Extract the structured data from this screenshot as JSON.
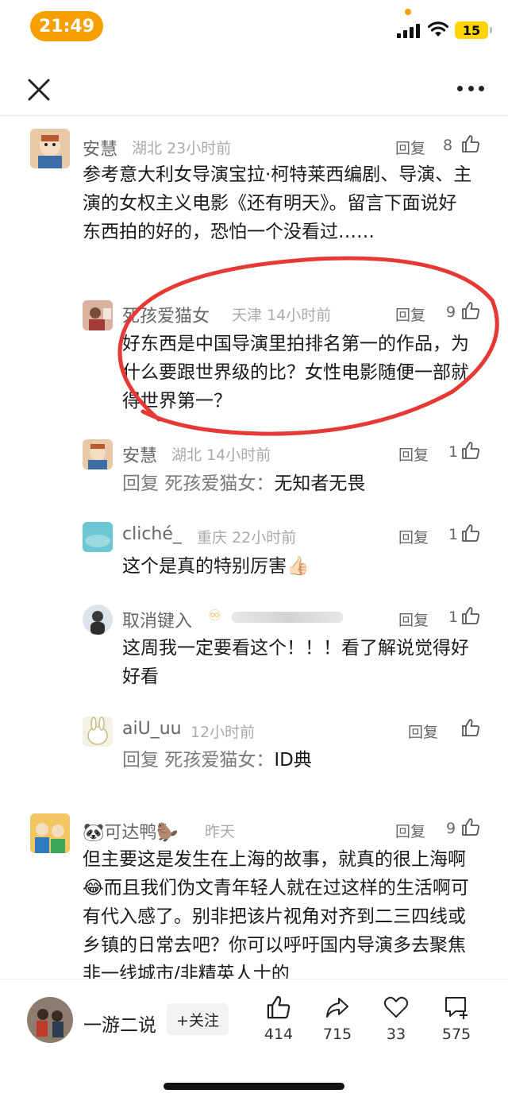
{
  "status": {
    "time": "21:49",
    "battery": "15"
  },
  "colors": {
    "accent": "#f5a000",
    "annotation": "#e53935",
    "battery": "#ffd400"
  },
  "nav": {
    "close_icon": "close-icon",
    "more_icon": "more-dots-icon"
  },
  "reply_label": "回复",
  "comments": [
    {
      "name": "安慧",
      "location": "湖北",
      "time": "23小时前",
      "likes": "8",
      "text": "参考意大利女导演宝拉·柯特莱西编剧、导演、主演的女权主义电影《还有明天》。留言下面说好东西拍的好的，恐怕一个没看过……"
    },
    {
      "name": "死孩爱猫女",
      "location": "天津",
      "time": "14小时前",
      "likes": "9",
      "text": "好东西是中国导演里拍排名第一的作品，为什么要跟世界级的比？女性电影随便一部就得世界第一？"
    },
    {
      "name": "安慧",
      "location": "湖北",
      "time": "14小时前",
      "likes": "1",
      "reply_prefix": "回复",
      "reply_target": "死孩爱猫女：",
      "text": "无知者无畏"
    },
    {
      "name": "cliché_",
      "location": "重庆",
      "time": "22小时前",
      "likes": "1",
      "text": "这个是真的特别厉害👍🏻"
    },
    {
      "name": "取消键入",
      "badge": "♾",
      "time": "",
      "likes": "1",
      "text": "这周我一定要看这个！！！看了解说觉得好好看"
    },
    {
      "name": "aiU_uu",
      "time": "12小时前",
      "likes": "",
      "reply_prefix": "回复",
      "reply_target": "死孩爱猫女：",
      "text": "ID典"
    },
    {
      "name": "🐼可达鸭🦫",
      "time": "昨天",
      "likes": "9",
      "text": "但主要这是发生在上海的故事，就真的很上海啊😂而且我们伪文青年轻人就在过这样的生活啊可有代入感了。别非把该片视角对齐到二三四线或乡镇的日常去吧？你可以呼吁国内导演多去聚焦非一线城市/非精英人士的"
    }
  ],
  "bottom": {
    "author": "一游二说",
    "follow": "+关注",
    "likes": "414",
    "shares": "715",
    "favorites": "33",
    "comments": "575"
  }
}
